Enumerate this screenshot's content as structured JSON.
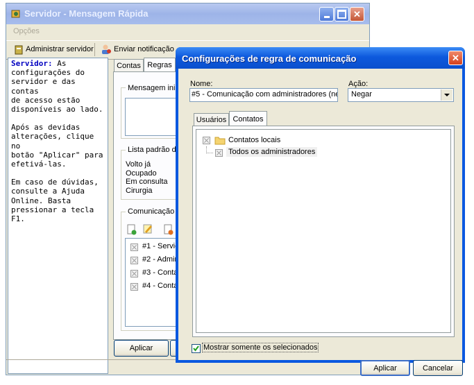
{
  "main_window": {
    "title": "Servidor - Mensagem Rápida",
    "menu": [
      "Opções"
    ],
    "toolbar": {
      "admin_label": "Administrar servidor",
      "notify_label": "Enviar notificação"
    },
    "help": {
      "heading": "Servidor:",
      "lines": [
        "configurações do",
        "servidor e das contas",
        "de acesso estão",
        "disponíveis ao lado.",
        "",
        "Após as devidas",
        "alterações, clique no",
        "botão \"Aplicar\" para",
        "efetivá-las.",
        "",
        "Em caso de dúvidas,",
        "consulte a Ajuda",
        "Online. Basta",
        "pressionar a tecla F1."
      ],
      "first_line_rest": " As"
    },
    "tabs": [
      "Contas",
      "Regras"
    ],
    "group_initial": "Mensagem inic",
    "group_default_list": "Lista padrão de",
    "status_list": [
      "Volto já",
      "Ocupado",
      "Em consulta",
      "Cirurgia"
    ],
    "group_comm": "Comunicação",
    "rules": [
      "#1 - Servic",
      "#2 - Admin",
      "#3 - Conta",
      "#4 - Conta"
    ],
    "apply_label": "Aplicar"
  },
  "dialog": {
    "title": "Configurações de regra de comunicação",
    "name_label": "Nome:",
    "name_value": "#5 - Comunicação com administradores (ne",
    "action_label": "Ação:",
    "action_value": "Negar",
    "tabs": [
      "Usuários",
      "Contatos"
    ],
    "tree": {
      "root": "Contatos locais",
      "child": "Todos os administradores"
    },
    "show_selected_label": "Mostrar somente os selecionados",
    "ok_label": "Aplicar",
    "cancel_label": "Cancelar"
  },
  "colors": {
    "accent_title": "#0a58e0",
    "close_red": "#e2572f",
    "help_heading": "#0000c0"
  }
}
